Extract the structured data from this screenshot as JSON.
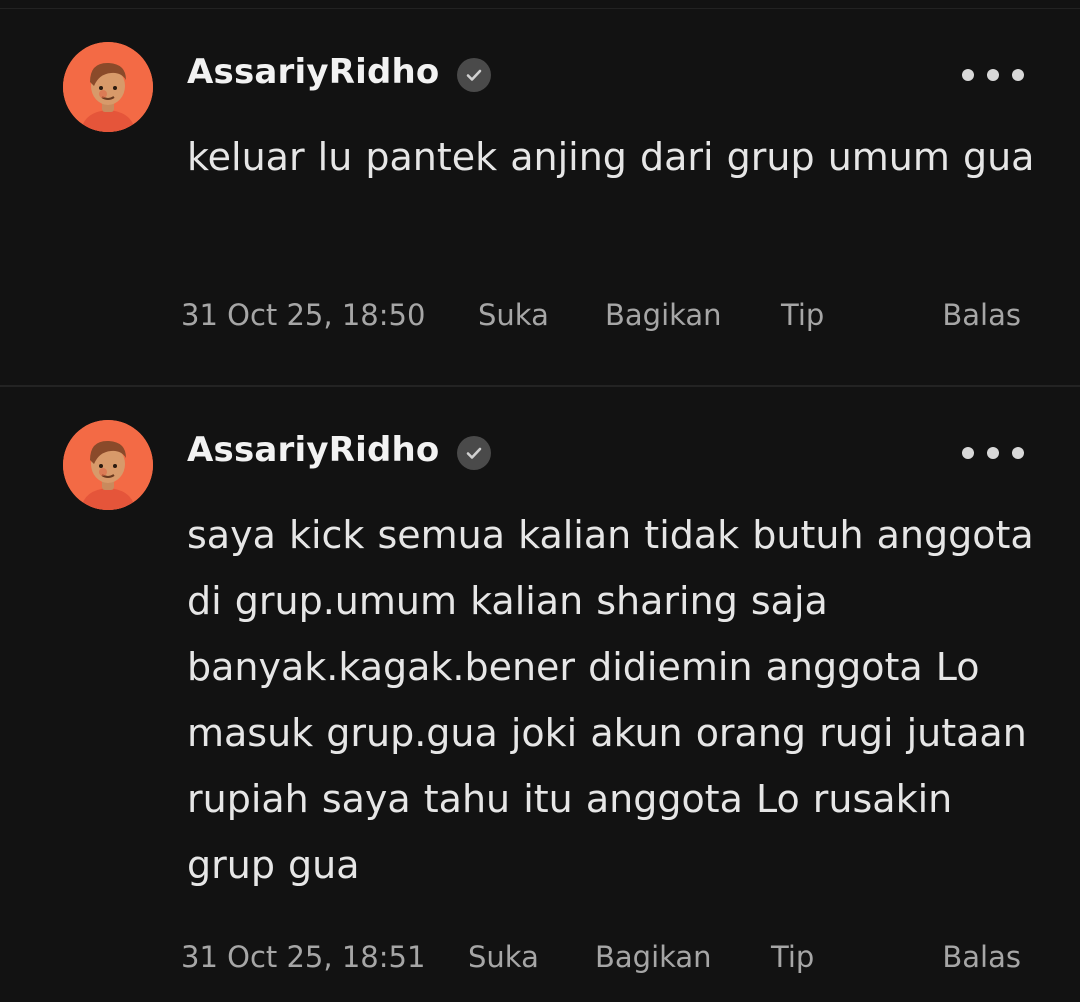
{
  "colors": {
    "background": "#121212",
    "avatar_bg": "#f36a45",
    "username": "#f2f2f2",
    "body_text": "#e6e6e6",
    "meta_text": "#a6a6a6"
  },
  "comments": [
    {
      "username": "AssariyRidho",
      "verified_icon": "check-badge-icon",
      "more_icon": "more-dots-icon",
      "text": "keluar lu pantek anjing dari grup umum gua",
      "timestamp": "31 Oct 25, 18:50",
      "like_label": "Suka",
      "share_label": "Bagikan",
      "tip_label": "Tip",
      "reply_label": "Balas"
    },
    {
      "username": "AssariyRidho",
      "verified_icon": "check-badge-icon",
      "more_icon": "more-dots-icon",
      "text": "saya kick semua kalian tidak butuh anggota di grup.umum kalian sharing saja banyak.kagak.bener didiemin anggota Lo masuk grup.gua joki akun orang rugi jutaan rupiah saya tahu itu anggota Lo rusakin grup gua",
      "timestamp": "31 Oct 25, 18:51",
      "like_label": "Suka",
      "share_label": "Bagikan",
      "tip_label": "Tip",
      "reply_label": "Balas"
    }
  ]
}
